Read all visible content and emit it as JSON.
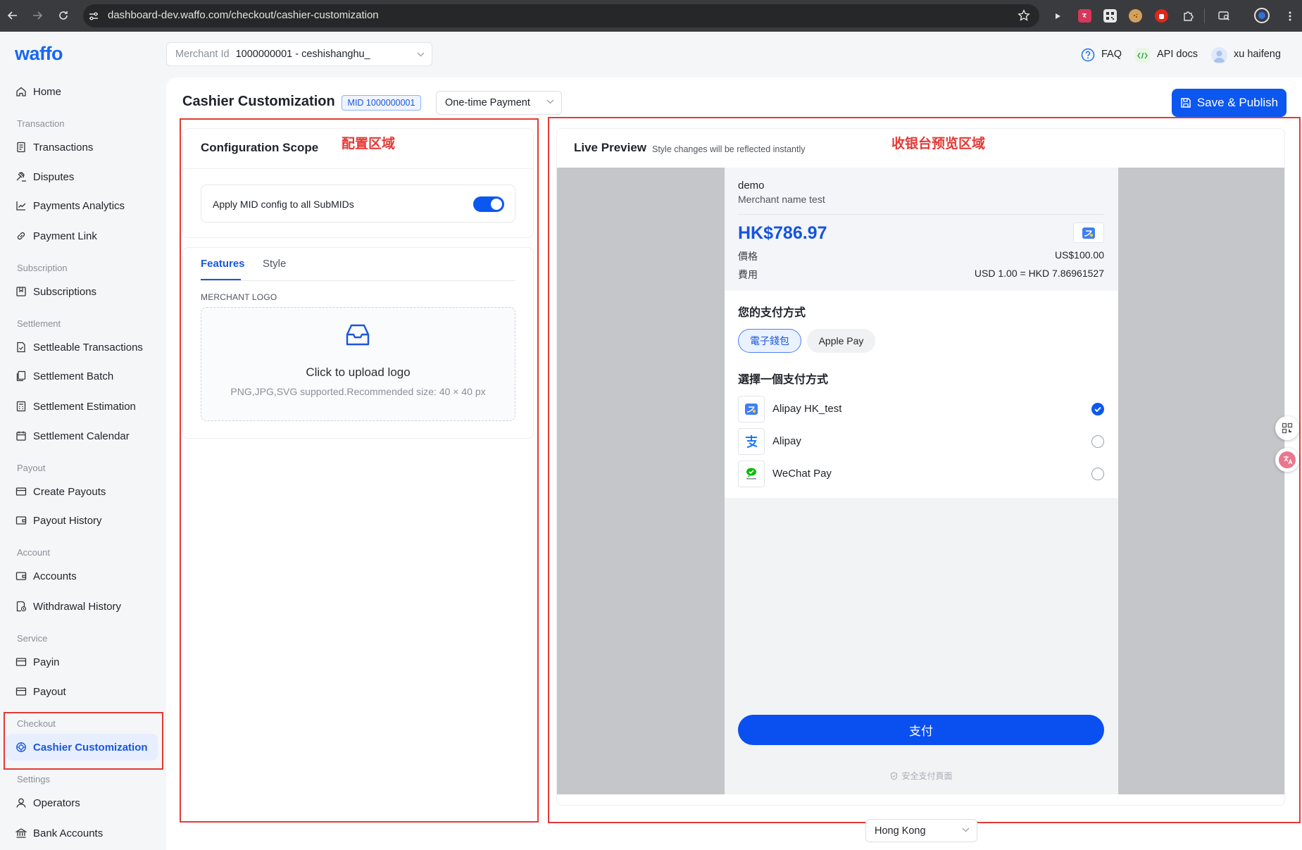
{
  "browser": {
    "url": "dashboard-dev.waffo.com/checkout/cashier-customization",
    "extension_icons": [
      "play-icon",
      "translate-icon",
      "qr-code-icon",
      "cookie-icon",
      "stop-icon",
      "puzzle-icon",
      "tab-search-icon",
      "profile-icon"
    ]
  },
  "app": {
    "logo": "waffo",
    "merchant_select": {
      "label": "Merchant Id",
      "value": "1000000001 - ceshishanghu_"
    },
    "header_links": {
      "faq": "FAQ",
      "api_docs": "API docs",
      "user": "xu haifeng"
    }
  },
  "sidebar": {
    "home": {
      "label": "Home",
      "icon": "home-icon"
    },
    "sections": [
      {
        "title": "Transaction",
        "items": [
          {
            "label": "Transactions",
            "icon": "receipt-icon"
          },
          {
            "label": "Disputes",
            "icon": "gavel-icon"
          },
          {
            "label": "Payments Analytics",
            "icon": "chart-icon"
          },
          {
            "label": "Payment Link",
            "icon": "link-icon"
          }
        ]
      },
      {
        "title": "Subscription",
        "items": [
          {
            "label": "Subscriptions",
            "icon": "bookmark-icon"
          }
        ]
      },
      {
        "title": "Settlement",
        "items": [
          {
            "label": "Settleable Transactions",
            "icon": "document-check-icon"
          },
          {
            "label": "Settlement Batch",
            "icon": "document-stack-icon"
          },
          {
            "label": "Settlement Estimation",
            "icon": "calculator-icon"
          },
          {
            "label": "Settlement Calendar",
            "icon": "calendar-icon"
          }
        ]
      },
      {
        "title": "Payout",
        "items": [
          {
            "label": "Create Payouts",
            "icon": "card-icon"
          },
          {
            "label": "Payout History",
            "icon": "wallet-icon"
          }
        ]
      },
      {
        "title": "Account",
        "items": [
          {
            "label": "Accounts",
            "icon": "wallet-icon"
          },
          {
            "label": "Withdrawal History",
            "icon": "document-clock-icon"
          }
        ]
      },
      {
        "title": "Service",
        "items": [
          {
            "label": "Payin",
            "icon": "card-icon"
          },
          {
            "label": "Payout",
            "icon": "card-icon"
          }
        ]
      },
      {
        "title": "Checkout",
        "items": [
          {
            "label": "Cashier Customization",
            "icon": "palette-icon",
            "active": true
          }
        ]
      },
      {
        "title": "Settings",
        "items": [
          {
            "label": "Operators",
            "icon": "user-icon"
          },
          {
            "label": "Bank Accounts",
            "icon": "bank-icon"
          }
        ]
      }
    ]
  },
  "page": {
    "title": "Cashier Customization",
    "mid_badge": "MID 1000000001",
    "payment_type": "One-time Payment",
    "save_button": "Save & Publish"
  },
  "annotations": {
    "config_area": "配置区域",
    "preview_area": "收银台预览区域"
  },
  "config": {
    "title": "Configuration Scope",
    "apply_toggle": {
      "label": "Apply MID config to all SubMIDs",
      "on": true
    },
    "tabs": [
      "Features",
      "Style"
    ],
    "active_tab": "Features",
    "merchant_logo_label": "MERCHANT LOGO",
    "upload": {
      "title": "Click to upload logo",
      "hint": "PNG,JPG,SVG supported.Recommended size: 40 × 40 px"
    }
  },
  "preview": {
    "title": "Live Preview",
    "subtitle": "Style changes will be reflected instantly",
    "checkout": {
      "merchant": "demo",
      "merchant_name": "Merchant name test",
      "amount": "HK$786.97",
      "price_label": "價格",
      "price_value": "US$100.00",
      "fee_label": "費用",
      "fee_value": "USD 1.00 = HKD 7.86961527",
      "methods_title": "您的支付方式",
      "method_chips": [
        {
          "label": "電子錢包",
          "selected": true
        },
        {
          "label": "Apple Pay",
          "selected": false
        }
      ],
      "select_title": "選擇一個支付方式",
      "options": [
        {
          "label": "Alipay HK_test",
          "icon": "alipay-hk-icon",
          "selected": true
        },
        {
          "label": "Alipay",
          "icon": "alipay-icon",
          "selected": false
        },
        {
          "label": "WeChat Pay",
          "icon": "wechat-pay-icon",
          "selected": false
        }
      ],
      "pay_button": "支付",
      "secure_note": "安全支付頁面"
    }
  },
  "region_select": "Hong Kong",
  "colors": {
    "primary": "#0b57f0",
    "annotation_red": "#e53935",
    "preview_backdrop": "#c4c6ca",
    "wechat_green": "#09bb07"
  }
}
